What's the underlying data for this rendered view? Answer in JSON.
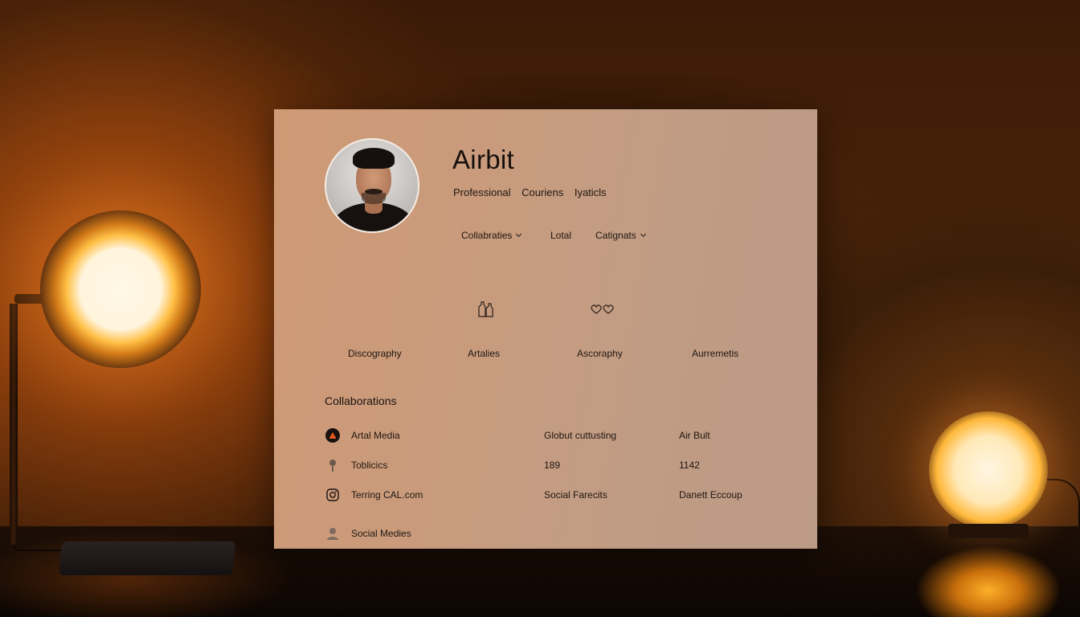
{
  "profile": {
    "name": "Airbit",
    "tags": [
      "Professional",
      "Couriens",
      "Iyaticls"
    ]
  },
  "menu": [
    {
      "label": "Collabraties",
      "has_dropdown": true
    },
    {
      "label": "Lotal",
      "has_dropdown": false
    },
    {
      "label": "Catignats",
      "has_dropdown": true
    }
  ],
  "stats": [
    {
      "label": "Discography",
      "icon": ""
    },
    {
      "label": "Artalies",
      "icon": "bottles-icon"
    },
    {
      "label": "Ascoraphy",
      "icon": "hearts-icon"
    },
    {
      "label": "Aurremetis",
      "icon": ""
    }
  ],
  "collaborations": {
    "title": "Collaborations",
    "rows": [
      {
        "icon": "media-badge-icon",
        "label": "Artal Media",
        "col2": "Globut cuttusting",
        "col3": "Air Bult"
      },
      {
        "icon": "pin-icon",
        "label": "Toblicics",
        "col2": "189",
        "col3": "1142"
      },
      {
        "icon": "instagram-icon",
        "label": "Terring CAL.com",
        "col2": "Social Farecits",
        "col3": "Danett Eccoup"
      },
      {
        "icon": "user-icon",
        "label": "Social Medies",
        "col2": "",
        "col3": ""
      }
    ]
  },
  "colors": {
    "card": "#c99b7c",
    "text": "#1b1411",
    "lamp_glow": "#ffb83a"
  }
}
